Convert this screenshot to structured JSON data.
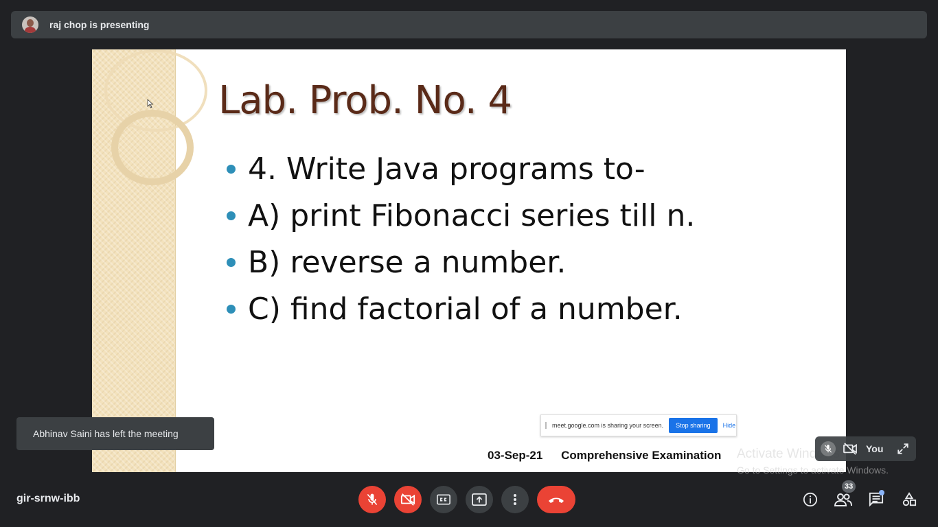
{
  "presenter": {
    "text": "raj chop is presenting"
  },
  "slide": {
    "title": "Lab. Prob. No. 4",
    "bullets": [
      "4. Write Java programs to-",
      "A) print Fibonacci series till n.",
      "B) reverse a number.",
      "C) find factorial of a number."
    ],
    "footer_date": "03-Sep-21",
    "footer_text": "Comprehensive Examination",
    "share_bar": {
      "message": "meet.google.com is sharing your screen.",
      "stop_label": "Stop sharing",
      "hide_label": "Hide"
    }
  },
  "self_view": {
    "label": "You"
  },
  "watermark": {
    "line1": "Activate Windows",
    "line2": "Go to Settings to activate Windows."
  },
  "toast": {
    "message": "Abhinav Saini has left the meeting"
  },
  "meeting": {
    "code": "gir-srnw-ibb",
    "participant_count": "33"
  },
  "colors": {
    "background": "#202124",
    "bar": "#3c4043",
    "danger": "#ea4335",
    "accent": "#1a73e8",
    "title": "#5a2a18",
    "bullet": "#2e8fb8"
  },
  "controls": {
    "icons": [
      "mic-off-icon",
      "camera-off-icon",
      "captions-icon",
      "present-icon",
      "more-options-icon",
      "end-call-icon"
    ]
  },
  "right_controls": {
    "icons": [
      "info-icon",
      "people-icon",
      "chat-icon",
      "activities-icon"
    ]
  }
}
